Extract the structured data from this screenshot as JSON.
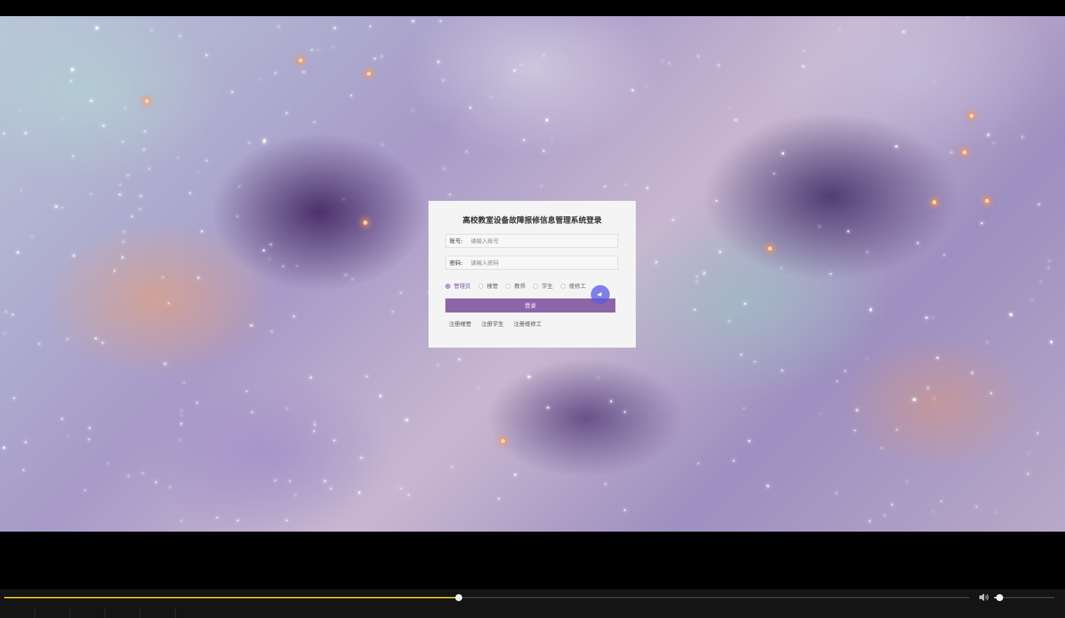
{
  "login": {
    "title": "高校教室设备故障报修信息管理系统登录",
    "account_label": "账号:",
    "account_placeholder": "请输入账号",
    "password_label": "密码:",
    "password_placeholder": "请输入密码",
    "roles": [
      {
        "label": "管理员",
        "selected": true
      },
      {
        "label": "楼管",
        "selected": false
      },
      {
        "label": "教师",
        "selected": false
      },
      {
        "label": "学生",
        "selected": false
      },
      {
        "label": "维修工",
        "selected": false
      }
    ],
    "login_button": "登录",
    "register_links": [
      "注册楼管",
      "注册学生",
      "注册维修工"
    ]
  },
  "player": {
    "progress_fraction": 0.471,
    "volume_fraction": 0.09,
    "accent_color": "#e8c21a"
  },
  "colors": {
    "button": "#8c64a8",
    "radio_selected": "#7d58a3",
    "card_background": "#f4f4f4"
  }
}
